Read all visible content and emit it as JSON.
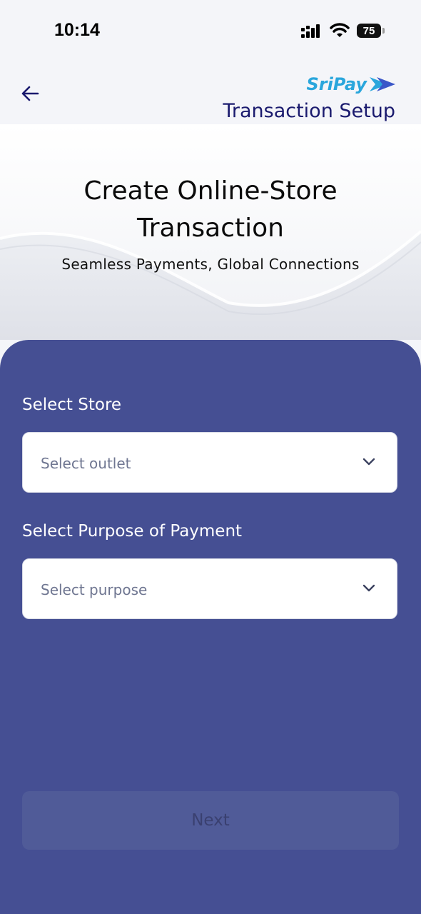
{
  "status_bar": {
    "time": "10:14",
    "battery": "75"
  },
  "header": {
    "brand": "SriPay",
    "title": "Transaction Setup"
  },
  "hero": {
    "title_line1": "Create Online-Store",
    "title_line2": "Transaction",
    "subtitle": "Seamless Payments, Global Connections"
  },
  "form": {
    "store_label": "Select Store",
    "store_placeholder": "Select outlet",
    "purpose_label": "Select Purpose of Payment",
    "purpose_placeholder": "Select purpose"
  },
  "actions": {
    "next_label": "Next"
  },
  "colors": {
    "panel": "#454f93",
    "brand_blue": "#2aa6dc",
    "title_navy": "#1a1a6e"
  }
}
